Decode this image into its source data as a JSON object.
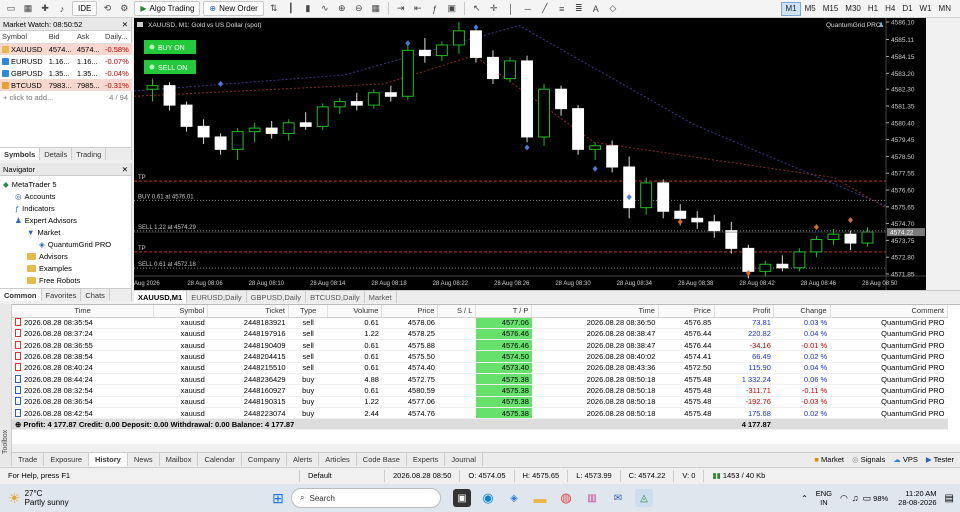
{
  "toolbar": {
    "ide_label": "IDE",
    "algo_trading_label": "Algo Trading",
    "new_order_label": "New Order",
    "timeframes": [
      "M1",
      "M5",
      "M15",
      "M30",
      "H1",
      "H4",
      "D1",
      "W1",
      "MN"
    ],
    "active_timeframe": "M1"
  },
  "market_watch": {
    "title": "Market Watch: 08:50:52",
    "columns": [
      "Symbol",
      "Bid",
      "Ask",
      "Daily..."
    ],
    "rows": [
      {
        "symbol": "XAUUSD",
        "bid": "4574...",
        "ask": "4574...",
        "daily": "-0.58%",
        "dir": "dn",
        "color": "#e8b84a"
      },
      {
        "symbol": "EURUSD",
        "bid": "1.16...",
        "ask": "1.16...",
        "daily": "-0.07%",
        "dir": "up",
        "color": "#2a8ae0"
      },
      {
        "symbol": "GBPUSD",
        "bid": "1.35...",
        "ask": "1.35...",
        "daily": "-0.04%",
        "dir": "up",
        "color": "#2a8ae0"
      },
      {
        "symbol": "BTCUSD",
        "bid": "7983...",
        "ask": "7985...",
        "daily": "-0.31%",
        "dir": "dn",
        "color": "#e8a030"
      }
    ],
    "add_placeholder": "click to add...",
    "count": "4 / 94",
    "tabs": [
      "Symbols",
      "Details",
      "Trading"
    ]
  },
  "navigator": {
    "title": "Navigator",
    "items": [
      {
        "label": "MetaTrader 5",
        "indent": 0,
        "icon": "mt5-icon"
      },
      {
        "label": "Accounts",
        "indent": 1,
        "icon": "accounts-icon"
      },
      {
        "label": "Indicators",
        "indent": 1,
        "icon": "indicators-icon"
      },
      {
        "label": "Expert Advisors",
        "indent": 1,
        "icon": "expert-icon"
      },
      {
        "label": "Market",
        "indent": 2,
        "icon": "market-icon"
      },
      {
        "label": "QuantumGrid PRO",
        "indent": 3,
        "icon": "ea-icon"
      },
      {
        "label": "Advisors",
        "indent": 2,
        "icon": "folder-icon"
      },
      {
        "label": "Examples",
        "indent": 2,
        "icon": "folder-icon"
      },
      {
        "label": "Free Robots",
        "indent": 2,
        "icon": "folder-icon"
      }
    ],
    "tabs": [
      "Common",
      "Favorites",
      "Chats"
    ]
  },
  "chart": {
    "symbol_title": "XAUUSD, M1:  Gold vs US Dollar (spot)",
    "ea_label": "QuantumGrid PRO",
    "buy_on_label": "BUY ON",
    "sell_on_label": "SELL ON",
    "line_labels": {
      "tp1": "TP",
      "buy": "BUY 0.61 at 4576.01",
      "sell1": "SELL 1.22 at 4574.29",
      "tp2": "TP",
      "sell2": "SELL 0.61 at 4572.18"
    },
    "price_ticks": [
      "4586.10",
      "4585.11",
      "4584.15",
      "4583.20",
      "4582.30",
      "4581.35",
      "4580.40",
      "4579.45",
      "4578.50",
      "4577.55",
      "4576.60",
      "4575.65",
      "4574.70",
      "4573.75",
      "4572.80",
      "4571.85"
    ],
    "current_price_label": "4574.22",
    "time_ticks": [
      "28 Aug 2026",
      "28 Aug 08:06",
      "28 Aug 08:10",
      "28 Aug 08:14",
      "28 Aug 08:18",
      "28 Aug 08:22",
      "28 Aug 08:26",
      "28 Aug 08:30",
      "28 Aug 08:34",
      "28 Aug 08:38",
      "28 Aug 08:42",
      "28 Aug 08:46",
      "28 Aug 08:50"
    ],
    "candles": [
      [
        4582.3,
        4582.9,
        4581.6,
        4582.5
      ],
      [
        4582.5,
        4582.7,
        4581.1,
        4581.4
      ],
      [
        4581.4,
        4581.6,
        4579.9,
        4580.2
      ],
      [
        4580.2,
        4580.6,
        4579.2,
        4579.6
      ],
      [
        4579.6,
        4579.8,
        4578.6,
        4578.9
      ],
      [
        4578.9,
        4580.1,
        4578.3,
        4579.9
      ],
      [
        4579.9,
        4580.4,
        4579.3,
        4580.1
      ],
      [
        4580.1,
        4580.5,
        4579.5,
        4579.8
      ],
      [
        4579.8,
        4580.6,
        4579.4,
        4580.4
      ],
      [
        4580.4,
        4581.0,
        4580.0,
        4580.2
      ],
      [
        4580.2,
        4581.5,
        4580.0,
        4581.3
      ],
      [
        4581.3,
        4581.8,
        4580.9,
        4581.6
      ],
      [
        4581.6,
        4582.1,
        4581.1,
        4581.4
      ],
      [
        4581.4,
        4582.3,
        4581.2,
        4582.1
      ],
      [
        4582.1,
        4582.5,
        4581.6,
        4581.9
      ],
      [
        4581.9,
        4584.9,
        4581.7,
        4584.5
      ],
      [
        4584.5,
        4585.2,
        4583.8,
        4584.2
      ],
      [
        4584.2,
        4585.0,
        4583.9,
        4584.8
      ],
      [
        4584.8,
        4586.1,
        4584.3,
        4585.6
      ],
      [
        4585.6,
        4585.9,
        4583.8,
        4584.1
      ],
      [
        4584.1,
        4584.5,
        4582.6,
        4582.9
      ],
      [
        4582.9,
        4584.1,
        4582.7,
        4583.9
      ],
      [
        4583.9,
        4584.2,
        4579.3,
        4579.6
      ],
      [
        4579.6,
        4582.6,
        4579.1,
        4582.3
      ],
      [
        4582.3,
        4582.5,
        4580.8,
        4581.2
      ],
      [
        4581.2,
        4581.4,
        4578.6,
        4578.9
      ],
      [
        4578.9,
        4579.3,
        4578.3,
        4579.1
      ],
      [
        4579.1,
        4579.4,
        4577.6,
        4577.9
      ],
      [
        4577.9,
        4578.5,
        4575.0,
        4575.6
      ],
      [
        4575.6,
        4577.3,
        4575.2,
        4577.0
      ],
      [
        4577.0,
        4577.2,
        4575.0,
        4575.4
      ],
      [
        4575.4,
        4575.8,
        4574.6,
        4575.0
      ],
      [
        4575.0,
        4575.4,
        4574.4,
        4574.8
      ],
      [
        4574.8,
        4575.2,
        4573.9,
        4574.3
      ],
      [
        4574.3,
        4574.8,
        4573.0,
        4573.3
      ],
      [
        4573.3,
        4573.5,
        4571.6,
        4572.0
      ],
      [
        4572.0,
        4572.6,
        4571.7,
        4572.4
      ],
      [
        4572.4,
        4572.9,
        4572.0,
        4572.2
      ],
      [
        4572.2,
        4573.3,
        4572.0,
        4573.1
      ],
      [
        4573.1,
        4574.0,
        4572.8,
        4573.8
      ],
      [
        4573.8,
        4574.4,
        4573.5,
        4574.1
      ],
      [
        4574.1,
        4574.3,
        4573.2,
        4573.6
      ],
      [
        4573.6,
        4574.5,
        4573.4,
        4574.22
      ]
    ],
    "tabs": [
      "XAUUSD,M1",
      "EURUSD,Daily",
      "GBPUSD,Daily",
      "BTCUSD,Daily",
      "Market"
    ]
  },
  "trade": {
    "columns": [
      "Time",
      "Symbol",
      "Ticket",
      "Type",
      "Volume",
      "Price",
      "S / L",
      "T / P",
      "Time",
      "Price",
      "Profit",
      "Change",
      "Comment"
    ],
    "rows": [
      {
        "time": "2026.08.28 08:35:54",
        "symbol": "xauusd",
        "ticket": "2448183921",
        "type": "sell",
        "volume": "0.61",
        "price": "4578.06",
        "sl": "",
        "tp": "4577.06",
        "ctime": "2026.08.28 08:36:50",
        "cprice": "4576.85",
        "profit": "73.81",
        "change": "0.03 %",
        "comment": "QuantumGrid PRO"
      },
      {
        "time": "2026.08.28 08:37:24",
        "symbol": "xauusd",
        "ticket": "2448197916",
        "type": "sell",
        "volume": "1.22",
        "price": "4578.25",
        "sl": "",
        "tp": "4576.46",
        "ctime": "2026.08.28 08:38:47",
        "cprice": "4576.44",
        "profit": "220.82",
        "change": "0.04 %",
        "comment": "QuantumGrid PRO"
      },
      {
        "time": "2026.08.28 08:36:55",
        "symbol": "xauusd",
        "ticket": "2448190409",
        "type": "sell",
        "volume": "0.61",
        "price": "4575.88",
        "sl": "",
        "tp": "4576.46",
        "ctime": "2026.08.28 08:38:47",
        "cprice": "4576.44",
        "profit": "-34.16",
        "change": "-0.01 %",
        "comment": "QuantumGrid PRO"
      },
      {
        "time": "2026.08.28 08:38:54",
        "symbol": "xauusd",
        "ticket": "2448204415",
        "type": "sell",
        "volume": "0.61",
        "price": "4575.50",
        "sl": "",
        "tp": "4574.50",
        "ctime": "2026.08.28 08:40:02",
        "cprice": "4574.41",
        "profit": "66.49",
        "change": "0.02 %",
        "comment": "QuantumGrid PRO"
      },
      {
        "time": "2026.08.28 08:40:24",
        "symbol": "xauusd",
        "ticket": "2448215510",
        "type": "sell",
        "volume": "0.61",
        "price": "4574.40",
        "sl": "",
        "tp": "4573.40",
        "ctime": "2026.08.28 08:43:36",
        "cprice": "4572.50",
        "profit": "115.90",
        "change": "0.04 %",
        "comment": "QuantumGrid PRO"
      },
      {
        "time": "2026.08.28 08:44:24",
        "symbol": "xauusd",
        "ticket": "2448236429",
        "type": "buy",
        "volume": "4.88",
        "price": "4572.75",
        "sl": "",
        "tp": "4575.38",
        "ctime": "2026.08.28 08:50:18",
        "cprice": "4575.48",
        "profit": "1 332.24",
        "change": "0.06 %",
        "comment": "QuantumGrid PRO"
      },
      {
        "time": "2026.08.28 08:32:54",
        "symbol": "xauusd",
        "ticket": "2448160927",
        "type": "buy",
        "volume": "0.61",
        "price": "4580.59",
        "sl": "",
        "tp": "4575.38",
        "ctime": "2026.08.28 08:50:18",
        "cprice": "4575.48",
        "profit": "-311.71",
        "change": "-0.11 %",
        "comment": "QuantumGrid PRO"
      },
      {
        "time": "2026.08.28 08:36:54",
        "symbol": "xauusd",
        "ticket": "2448190315",
        "type": "buy",
        "volume": "1.22",
        "price": "4577.06",
        "sl": "",
        "tp": "4575.38",
        "ctime": "2026.08.28 08:50:18",
        "cprice": "4575.48",
        "profit": "-192.76",
        "change": "-0.03 %",
        "comment": "QuantumGrid PRO"
      },
      {
        "time": "2026.08.28 08:42:54",
        "symbol": "xauusd",
        "ticket": "2448223074",
        "type": "buy",
        "volume": "2.44",
        "price": "4574.76",
        "sl": "",
        "tp": "4575.38",
        "ctime": "2026.08.28 08:50:18",
        "cprice": "4575.48",
        "profit": "175.68",
        "change": "0.02 %",
        "comment": "QuantumGrid PRO"
      }
    ],
    "summary": "Profit: 4 177.87  Credit: 0.00  Deposit: 0.00  Withdrawal: 0.00  Balance: 4 177.87",
    "summary_profit": "4 177.87"
  },
  "toolbox_label": "Toolbox",
  "bottom_tabs": [
    "Trade",
    "Exposure",
    "History",
    "News",
    "Mailbox",
    "Calendar",
    "Company",
    "Alerts",
    "Articles",
    "Code Base",
    "Experts",
    "Journal"
  ],
  "active_bottom_tab": "History",
  "bottom_right": {
    "market": "Market",
    "signals": "Signals",
    "vps": "VPS",
    "tester": "Tester"
  },
  "status": {
    "help": "For Help, press F1",
    "profile": "Default",
    "datetime": "2026.08.28 08:50",
    "open": "O: 4574.05",
    "high": "H: 4575.65",
    "low": "L: 4573.99",
    "close": "C: 4574.22",
    "volume": "V: 0",
    "traffic": "1453 / 40 Kb"
  },
  "taskbar": {
    "weather_temp": "27°C",
    "weather_desc": "Partly sunny",
    "search_placeholder": "Search",
    "lang1": "ENG",
    "lang2": "IN",
    "battery": "98%",
    "time": "11:20 AM",
    "date": "28-08-2026"
  }
}
